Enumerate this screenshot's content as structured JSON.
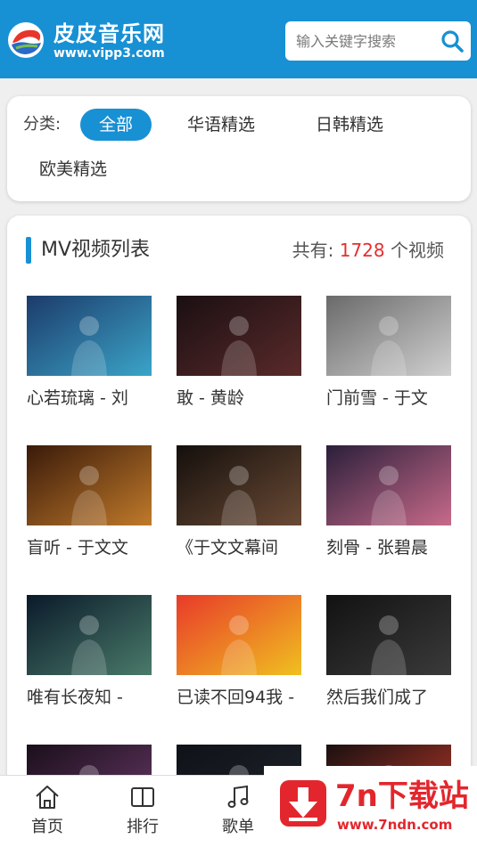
{
  "header": {
    "logo_title": "皮皮音乐网",
    "logo_url": "www.vipp3.com",
    "search_placeholder": "输入关键字搜索"
  },
  "categories": {
    "label": "分类:",
    "items": [
      {
        "label": "全部",
        "active": true
      },
      {
        "label": "华语精选",
        "active": false
      },
      {
        "label": "日韩精选",
        "active": false
      },
      {
        "label": "欧美精选",
        "active": false
      }
    ]
  },
  "mv_list": {
    "title": "MV视频列表",
    "count_prefix": "共有:",
    "count": "1728",
    "count_suffix": "个视频",
    "videos": [
      {
        "title": "心若琉璃 - 刘",
        "thumb_colors": [
          "#1c3b6a",
          "#3ba4c8"
        ]
      },
      {
        "title": "敢 - 黄龄",
        "thumb_colors": [
          "#1a0f12",
          "#5a2a2a"
        ]
      },
      {
        "title": "门前雪 - 于文",
        "thumb_colors": [
          "#6a6a6a",
          "#d0d0d0"
        ]
      },
      {
        "title": "盲听 - 于文文",
        "thumb_colors": [
          "#3a1a0a",
          "#c07a2a"
        ]
      },
      {
        "title": "《于文文幕间",
        "thumb_colors": [
          "#140f0c",
          "#6a4a35"
        ]
      },
      {
        "title": "刻骨 - 张碧晨",
        "thumb_colors": [
          "#2a1f3a",
          "#c86a8a"
        ]
      },
      {
        "title": "唯有长夜知 -",
        "thumb_colors": [
          "#0a1a2a",
          "#4a7a6a"
        ]
      },
      {
        "title": "已读不回94我 -",
        "thumb_colors": [
          "#e83a2a",
          "#f0c020"
        ]
      },
      {
        "title": "然后我们成了",
        "thumb_colors": [
          "#121212",
          "#3a3a3a"
        ]
      },
      {
        "title": "",
        "thumb_colors": [
          "#1a0f1a",
          "#6a3a6a"
        ]
      },
      {
        "title": "",
        "thumb_colors": [
          "#0f1218",
          "#20242c"
        ]
      },
      {
        "title": "",
        "thumb_colors": [
          "#1a1010",
          "#c03a2a"
        ]
      }
    ]
  },
  "bottom_nav": {
    "items": [
      {
        "label": "首页",
        "icon": "home-icon"
      },
      {
        "label": "排行",
        "icon": "book-icon"
      },
      {
        "label": "歌单",
        "icon": "music-note-icon"
      }
    ]
  },
  "watermark": {
    "title": "7n下载站",
    "url": "www.7ndn.com"
  },
  "colors": {
    "accent": "#1890d4",
    "count": "#e23030",
    "watermark": "#e3262d"
  }
}
